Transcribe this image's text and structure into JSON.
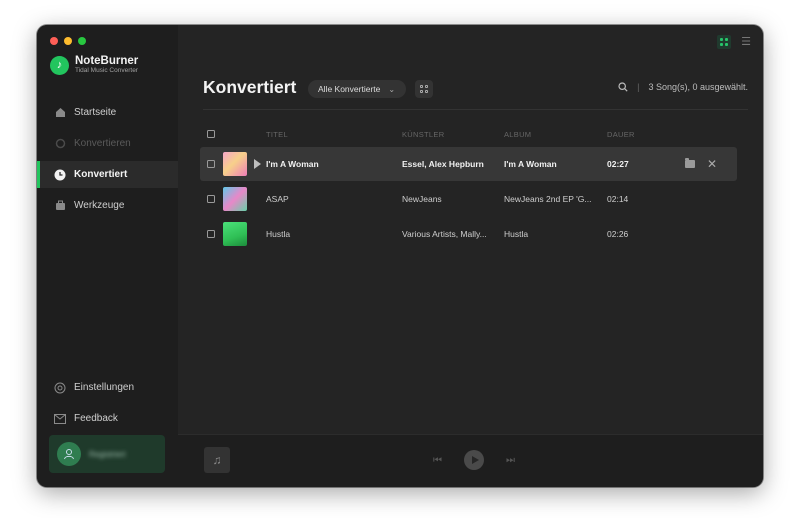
{
  "app": {
    "name": "NoteBurner",
    "subtitle": "Tidal Music Converter"
  },
  "sidebar": {
    "items": [
      {
        "label": "Startseite",
        "icon": "home-icon",
        "state": "normal"
      },
      {
        "label": "Konvertieren",
        "icon": "convert-icon",
        "state": "disabled"
      },
      {
        "label": "Konvertiert",
        "icon": "clock-icon",
        "state": "active"
      },
      {
        "label": "Werkzeuge",
        "icon": "toolbox-icon",
        "state": "normal"
      }
    ],
    "bottom_items": [
      {
        "label": "Einstellungen",
        "icon": "gear-icon"
      },
      {
        "label": "Feedback",
        "icon": "mail-icon"
      }
    ],
    "user_label": "Registriert"
  },
  "header": {
    "title": "Konvertiert",
    "filter_label": "Alle Konvertierte",
    "selection_status": "3 Song(s), 0 ausgewählt."
  },
  "table": {
    "columns": [
      "TITEL",
      "KÜNSTLER",
      "ALBUM",
      "DAUER"
    ],
    "rows": [
      {
        "title": "I'm A Woman",
        "artist": "Essel, Alex Hepburn",
        "album": "I'm A Woman",
        "duration": "02:27",
        "highlighted": true
      },
      {
        "title": "ASAP",
        "artist": "NewJeans",
        "album": "NewJeans 2nd EP 'G...",
        "duration": "02:14",
        "highlighted": false
      },
      {
        "title": "Hustla",
        "artist": "Various Artists, Mally...",
        "album": "Hustla",
        "duration": "02:26",
        "highlighted": false
      }
    ]
  },
  "colors": {
    "accent": "#22c55e",
    "background": "#242424",
    "sidebar": "#1e1e1e"
  }
}
